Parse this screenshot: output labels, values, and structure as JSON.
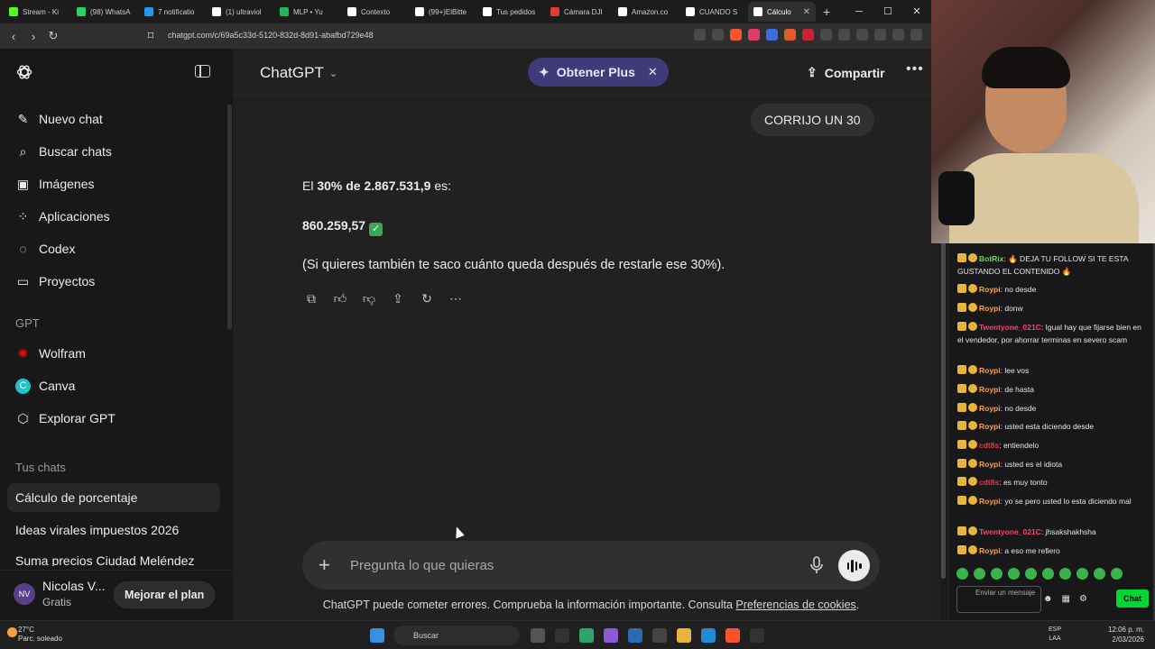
{
  "browser": {
    "tabs": [
      {
        "label": "Stream - Ki",
        "color": "#53fc18"
      },
      {
        "label": "(98) WhatsA",
        "color": "#25d366"
      },
      {
        "label": "7 notificatio",
        "color": "#1d9bf0"
      },
      {
        "label": "(1) ultraviol",
        "color": "#ffffff"
      },
      {
        "label": "MLP • Yu",
        "color": "#1db954"
      },
      {
        "label": "Contexto",
        "color": "#ffffff"
      },
      {
        "label": "(99+)ElBitte",
        "color": "#ffffff"
      },
      {
        "label": "Tus pedidos",
        "color": "#ffffff"
      },
      {
        "label": "Cámara DJI",
        "color": "#e03c31"
      },
      {
        "label": "Amazon.co",
        "color": "#ffffff"
      },
      {
        "label": "CUANDO S",
        "color": "#ffffff"
      },
      {
        "label": "Cálculo",
        "color": "#ffffff",
        "active": true
      }
    ],
    "url": "chatgpt.com/c/69a5c33d-5120-832d-8d91-abafbd729e48"
  },
  "sidebar": {
    "items": [
      {
        "label": "Nuevo chat",
        "icon": "new-chat-icon"
      },
      {
        "label": "Buscar chats",
        "icon": "search-icon"
      },
      {
        "label": "Imágenes",
        "icon": "images-icon"
      },
      {
        "label": "Aplicaciones",
        "icon": "apps-icon"
      },
      {
        "label": "Codex",
        "icon": "codex-icon"
      },
      {
        "label": "Proyectos",
        "icon": "folder-icon"
      }
    ],
    "gpt_heading": "GPT",
    "gpts": [
      {
        "label": "Wolfram",
        "icon": "wolfram-icon",
        "color": "#dd1100"
      },
      {
        "label": "Canva",
        "icon": "canva-icon",
        "color": "#20c4cb"
      },
      {
        "label": "Explorar GPT",
        "icon": "explore-gpt-icon"
      }
    ],
    "chats_heading": "Tus chats",
    "chats": [
      {
        "label": "Cálculo de porcentaje",
        "active": true
      },
      {
        "label": "Ideas virales impuestos 2026"
      },
      {
        "label": "Suma precios Ciudad Meléndez"
      }
    ],
    "profile": {
      "initials": "NV",
      "name": "Nicolas V...",
      "plan": "Gratis",
      "upgrade_label": "Mejorar el plan"
    }
  },
  "header": {
    "model": "ChatGPT",
    "plus_label": "Obtener Plus",
    "share_label": "Compartir"
  },
  "conversation": {
    "user_message": "CORRIJO UN 30",
    "answer": {
      "line1_prefix": "El ",
      "line1_bold": "30% de 2.867.531,9",
      "line1_suffix": " es:",
      "result": "860.259,57",
      "followup": "(Si quieres también te saco cuánto queda después de restarle ese 30%)."
    }
  },
  "composer": {
    "placeholder": "Pregunta lo que quieras",
    "disclaimer": "ChatGPT puede cometer errores. Comprueba la información importante. Consulta ",
    "disclaimer_link": "Preferencias de cookies",
    "disclaimer_end": "."
  },
  "stream_chat": {
    "messages": [
      {
        "user": "BotRix",
        "color": "#7bd35a",
        "text": ": 🔥 DEJA TU FOLLOW SI TE ESTA GUSTANDO EL CONTENIDO 🔥"
      },
      {
        "user": "Roypi",
        "color": "#ff9f43",
        "text": ": no desde"
      },
      {
        "user": "Roypi",
        "color": "#ff9f43",
        "text": ": donw"
      },
      {
        "user": "Twentyone_021C",
        "color": "#ff3f6a",
        "text": ": Igual hay que fijarse bien en el vendedor, por ahorrar terminas en severo scam"
      },
      {
        "user": "Roypi",
        "color": "#ff9f43",
        "text": ": lee vos"
      },
      {
        "user": "Roypi",
        "color": "#ff9f43",
        "text": ": de hasta"
      },
      {
        "user": "Roypi",
        "color": "#ff9f43",
        "text": ": no desde"
      },
      {
        "user": "Roypi",
        "color": "#ff9f43",
        "text": ": usted esta diciendo desde"
      },
      {
        "user": "cdt8s",
        "color": "#e63b3b",
        "text": ": entiendelo"
      },
      {
        "user": "Roypi",
        "color": "#ff9f43",
        "text": ": usted es el idiota"
      },
      {
        "user": "cdt8s",
        "color": "#e63b3b",
        "text": ": es muy tonto"
      },
      {
        "user": "Roypi",
        "color": "#ff9f43",
        "text": ": yo se pero usted lo esta diciendo mal"
      },
      {
        "user": "Twentyone_021C",
        "color": "#ff3f6a",
        "text": ": jhsakshakhsha"
      },
      {
        "user": "Roypi",
        "color": "#ff9f43",
        "text": ": a eso me refiero"
      }
    ],
    "input_placeholder": "Enviar un mensaje",
    "send_label": "Chat"
  },
  "taskbar": {
    "weather_temp": "27°C",
    "weather_desc": "Parc. soleado",
    "search_label": "Buscar",
    "lang_top": "ESP",
    "lang_bottom": "LAA",
    "time": "12:06 p. m.",
    "date": "2/03/2026"
  }
}
